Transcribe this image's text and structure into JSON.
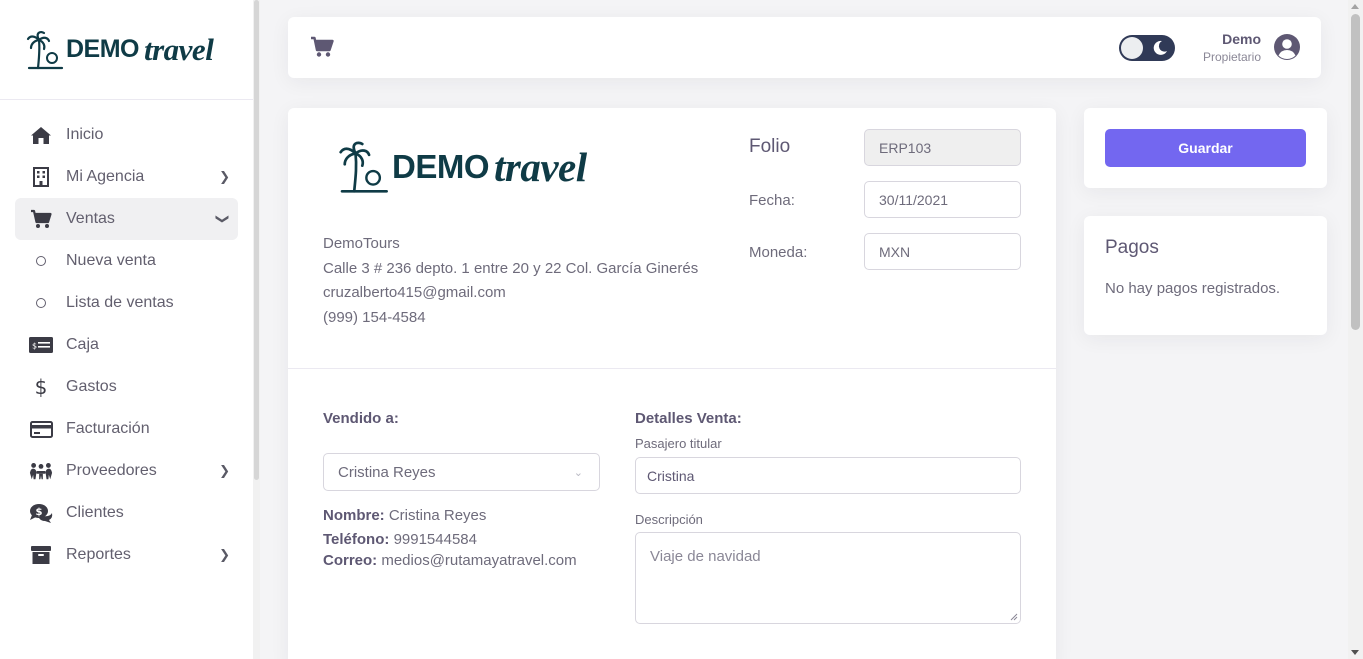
{
  "brand": {
    "logo_text_1": "DEMO",
    "logo_text_2": "travel"
  },
  "sidebar": {
    "items": [
      {
        "label": "Inicio",
        "icon": "home-icon"
      },
      {
        "label": "Mi Agencia",
        "icon": "building-icon",
        "has_children": true
      },
      {
        "label": "Ventas",
        "icon": "cart-icon",
        "expanded": true
      },
      {
        "label": "Nueva venta",
        "icon": "circle-icon",
        "sub": true
      },
      {
        "label": "Lista de ventas",
        "icon": "circle-icon",
        "sub": true
      },
      {
        "label": "Caja",
        "icon": "cash-register-icon"
      },
      {
        "label": "Gastos",
        "icon": "dollar-icon"
      },
      {
        "label": "Facturación",
        "icon": "credit-card-icon"
      },
      {
        "label": "Proveedores",
        "icon": "people-icon",
        "has_children": true
      },
      {
        "label": "Clientes",
        "icon": "comments-dollar-icon"
      },
      {
        "label": "Reportes",
        "icon": "archive-icon",
        "has_children": true
      }
    ]
  },
  "header": {
    "user_name": "Demo",
    "user_role": "Propietario",
    "theme": "dark-toggle"
  },
  "invoice": {
    "company": {
      "name": "DemoTours",
      "address": "Calle 3 # 236 depto. 1 entre 20 y 22 Col. García Ginerés",
      "email": "cruzalberto415@gmail.com",
      "phone": "(999) 154-4584"
    },
    "folio_label": "Folio",
    "folio_value": "ERP103",
    "fecha_label": "Fecha:",
    "fecha_value": "30/11/2021",
    "moneda_label": "Moneda:",
    "moneda_value": "MXN",
    "sold_to_title": "Vendido a:",
    "customer_selected": "Cristina Reyes",
    "nombre_label": "Nombre:",
    "nombre_value": "Cristina Reyes",
    "telefono_label": "Teléfono:",
    "telefono_value": "9991544584",
    "correo_label": "Correo:",
    "correo_value": "medios@rutamayatravel.com",
    "details_title": "Detalles Venta:",
    "pasajero_label": "Pasajero titular",
    "pasajero_value": "Cristina",
    "descripcion_label": "Descripción",
    "descripcion_value": "Viaje de navidad"
  },
  "actions": {
    "save_label": "Guardar"
  },
  "payments": {
    "title": "Pagos",
    "empty_text": "No hay pagos registrados."
  },
  "colors": {
    "primary": "#7367f0",
    "logo": "#0f3b46",
    "toggle": "#303a57"
  }
}
